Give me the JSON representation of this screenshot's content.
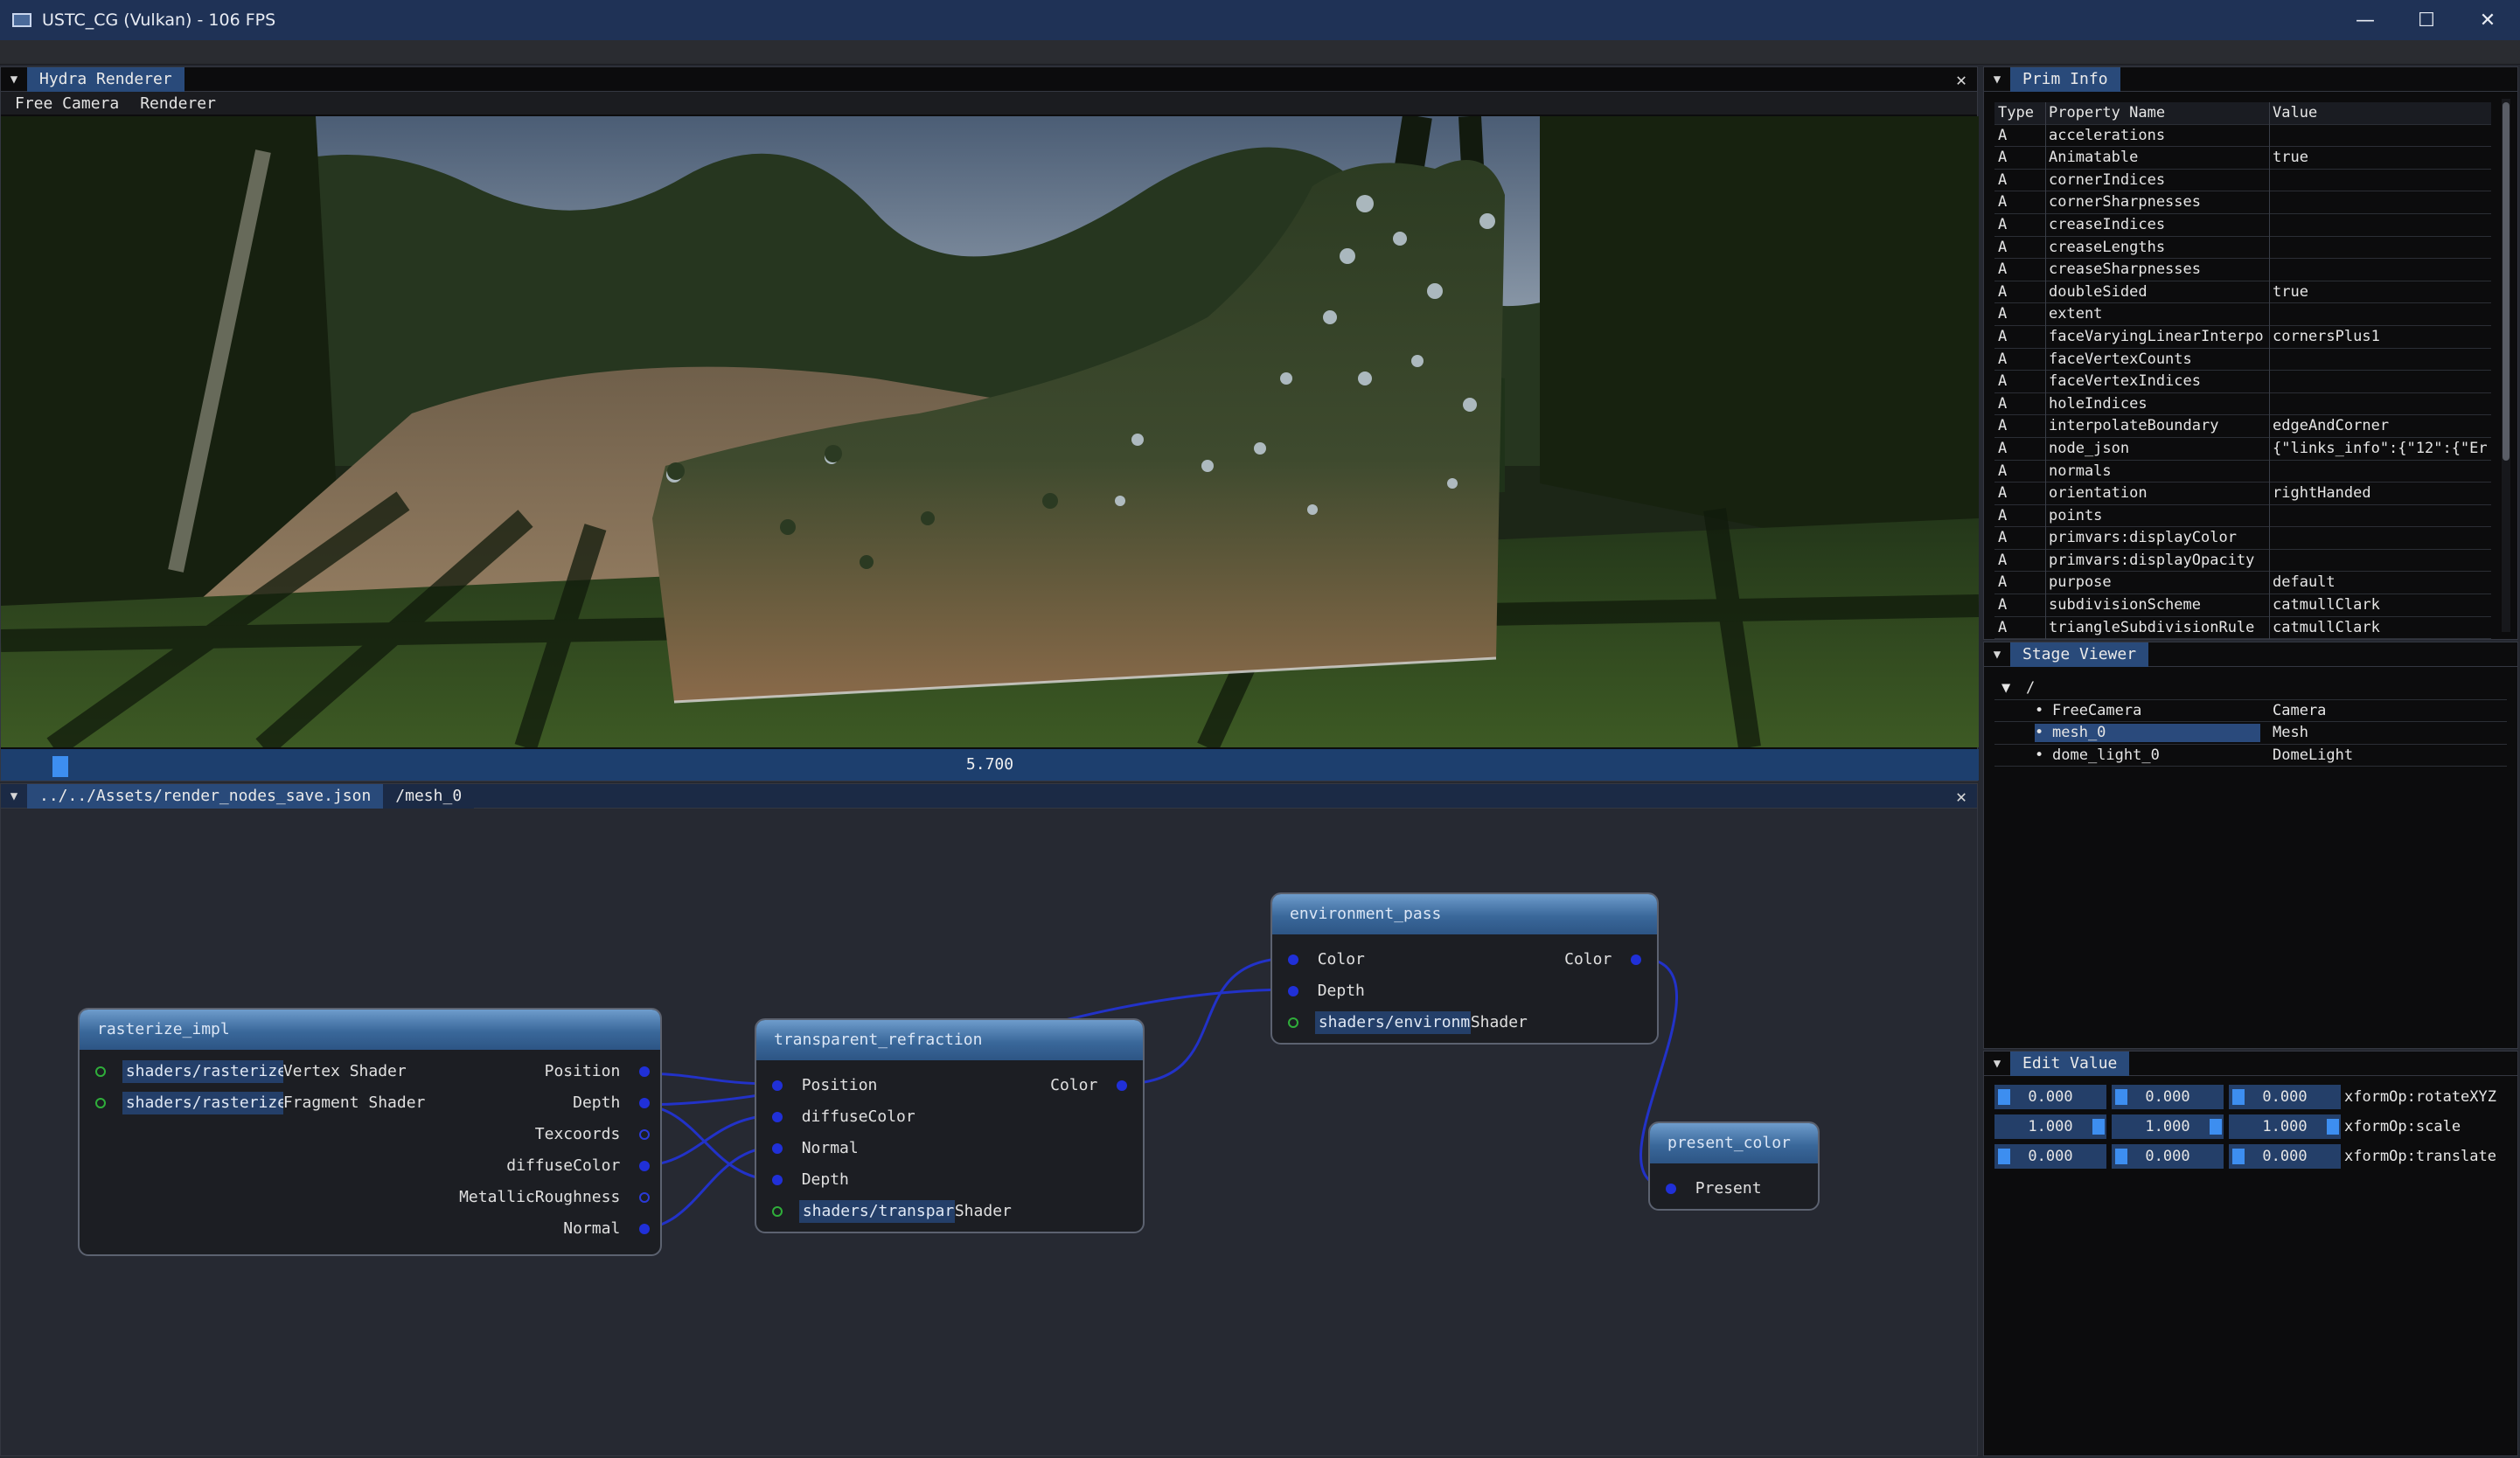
{
  "window": {
    "title": "USTC_CG (Vulkan) - 106 FPS",
    "minimize": "—",
    "maximize": "☐",
    "close": "✕"
  },
  "hydra": {
    "tab": "Hydra Renderer",
    "menu": [
      "Free Camera",
      "Renderer"
    ],
    "timeline_value": "5.700",
    "timeline_fraction": 0.026
  },
  "nodegraph": {
    "tabs": [
      "../../Assets/render_nodes_save.json",
      "/mesh_0"
    ],
    "nodes": {
      "rasterize": {
        "title": "rasterize_impl",
        "inputs": [
          {
            "field": "shaders/rasterize",
            "label": "Vertex Shader"
          },
          {
            "field": "shaders/rasterize",
            "label": "Fragment Shader"
          }
        ],
        "outputs": [
          "Position",
          "Depth",
          "Texcoords",
          "diffuseColor",
          "MetallicRoughness",
          "Normal"
        ]
      },
      "transparent": {
        "title": "transparent_refraction",
        "inputs": [
          "Position",
          "diffuseColor",
          "Normal",
          "Depth"
        ],
        "shader_field": "shaders/transpare",
        "shader_label": "Shader",
        "output": "Color"
      },
      "environment": {
        "title": "environment_pass",
        "inputs": [
          "Color",
          "Depth"
        ],
        "shader_field": "shaders/environme",
        "shader_label": "Shader",
        "output": "Color"
      },
      "present": {
        "title": "present_color",
        "input": "Present"
      }
    }
  },
  "priminfo": {
    "tab": "Prim Info",
    "headers": [
      "Type",
      "Property Name",
      "Value"
    ],
    "rows": [
      [
        "A",
        "accelerations",
        ""
      ],
      [
        "A",
        "Animatable",
        "true"
      ],
      [
        "A",
        "cornerIndices",
        ""
      ],
      [
        "A",
        "cornerSharpnesses",
        ""
      ],
      [
        "A",
        "creaseIndices",
        ""
      ],
      [
        "A",
        "creaseLengths",
        ""
      ],
      [
        "A",
        "creaseSharpnesses",
        ""
      ],
      [
        "A",
        "doubleSided",
        "true"
      ],
      [
        "A",
        "extent",
        ""
      ],
      [
        "A",
        "faceVaryingLinearInterpo",
        "cornersPlus1"
      ],
      [
        "A",
        "faceVertexCounts",
        ""
      ],
      [
        "A",
        "faceVertexIndices",
        ""
      ],
      [
        "A",
        "holeIndices",
        ""
      ],
      [
        "A",
        "interpolateBoundary",
        "edgeAndCorner"
      ],
      [
        "A",
        "node_json",
        "{\"links_info\":{\"12\":{\"Er"
      ],
      [
        "A",
        "normals",
        ""
      ],
      [
        "A",
        "orientation",
        "rightHanded"
      ],
      [
        "A",
        "points",
        ""
      ],
      [
        "A",
        "primvars:displayColor",
        ""
      ],
      [
        "A",
        "primvars:displayOpacity",
        ""
      ],
      [
        "A",
        "purpose",
        "default"
      ],
      [
        "A",
        "subdivisionScheme",
        "catmullClark"
      ],
      [
        "A",
        "triangleSubdivisionRule",
        "catmullClark"
      ]
    ]
  },
  "stage": {
    "tab": "Stage Viewer",
    "root": "/",
    "rows": [
      {
        "name": "FreeCamera",
        "type": "Camera"
      },
      {
        "name": "mesh_0",
        "type": "Mesh"
      },
      {
        "name": "dome_light_0",
        "type": "DomeLight"
      }
    ]
  },
  "editvalue": {
    "tab": "Edit Value",
    "rows": [
      {
        "values": [
          "0.000",
          "0.000",
          "0.000"
        ],
        "label": "xformOp:rotateXYZ"
      },
      {
        "values": [
          "1.000",
          "1.000",
          "1.000"
        ],
        "label": "xformOp:scale"
      },
      {
        "values": [
          "0.000",
          "0.000",
          "0.000"
        ],
        "label": "xformOp:translate"
      }
    ]
  },
  "colors": {
    "accent": "#294a7a",
    "pin": "#2030d8",
    "wire": "#2232c8",
    "titlebar": "#1f3256"
  }
}
